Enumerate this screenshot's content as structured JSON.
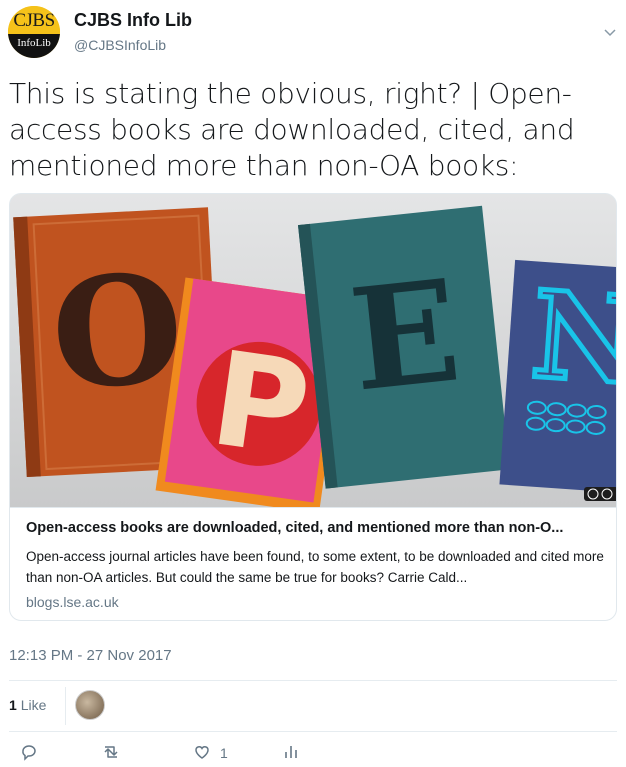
{
  "account": {
    "name": "CJBS Info Lib",
    "handle": "@CJBSInfoLib",
    "avatar_top": "CJBS",
    "avatar_bottom": "InfoLib"
  },
  "tweet": {
    "text": "This is stating the obvious, right? | Open-access books are downloaded, cited, and mentioned more than non-OA books:",
    "timestamp": "12:13 PM - 27 Nov 2017"
  },
  "card": {
    "title": "Open-access books are downloaded, cited, and mentioned more than non-O...",
    "description": "Open-access journal articles have been found, to some extent, to be downloaded and cited more than non-OA articles. But could the same be true for books? Carrie Cald...",
    "domain": "blogs.lse.ac.uk",
    "image_letters": [
      "O",
      "P",
      "E",
      "N"
    ],
    "cc_badge": "cc"
  },
  "stats": {
    "like_count": "1",
    "like_label": "Like"
  },
  "actions": {
    "reply_icon": "reply-icon",
    "retweet_icon": "retweet-icon",
    "like_icon": "heart-icon",
    "like_count": "1",
    "analytics_icon": "analytics-icon"
  },
  "colors": {
    "avatar_yellow": "#f5c21a",
    "book_o": "#c0531f",
    "book_p_pink": "#e8488a",
    "book_p_circle": "#d7262b",
    "book_e": "#2f6e72",
    "book_n": "#3d4f8a",
    "n_letter": "#19c4e8",
    "muted_text": "#657786"
  }
}
